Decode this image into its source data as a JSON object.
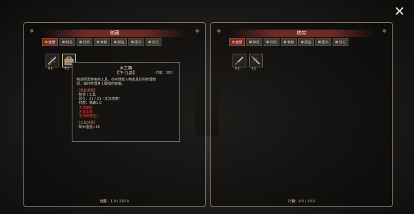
{
  "close_label": "×",
  "left_panel": {
    "title": "储藏",
    "tabs": [
      {
        "label": "全部",
        "active": true
      },
      {
        "label": "制造",
        "active": false
      },
      {
        "label": "药药",
        "active": false
      },
      {
        "label": "食粮",
        "active": false
      },
      {
        "label": "摸临",
        "active": false
      },
      {
        "label": "图书",
        "active": false
      },
      {
        "label": "其它",
        "active": false
      }
    ],
    "items": [
      {
        "icon": "saw-icon",
        "qty": "×1"
      },
      {
        "icon": "toolbox-icon",
        "qty": "×1"
      }
    ],
    "footer": "储藏：1.0 / 220.0"
  },
  "right_panel": {
    "title": "携带",
    "tabs": [
      {
        "label": "全部",
        "active": true
      },
      {
        "label": "制造",
        "active": false
      },
      {
        "label": "药药",
        "active": false
      },
      {
        "label": "食粮",
        "active": false
      },
      {
        "label": "摸临",
        "active": false
      },
      {
        "label": "图书",
        "active": false
      },
      {
        "label": "其它",
        "active": false
      }
    ],
    "items": [
      {
        "icon": "chisel-icon",
        "qty": "×1"
      },
      {
        "icon": "saw-icon",
        "qty": "×1"
      }
    ],
    "footer": "行囊：0.5 / 10.0"
  },
  "tooltip": {
    "name": "木工箱",
    "grade": "【下·九品】",
    "price": "· 价值：100",
    "desc1": "制造所需使用的工具，亦可随放入物道具栏的修理按",
    "desc2": "钮，临时修理身上破损的装备。",
    "section1": "【道具类型】",
    "type": "· 制造 / 工具",
    "durability": "· 耐久：21 / 21（无法修复）",
    "material": "· 材质：黄森1.0",
    "notes": [
      "· 无法精制",
      "· 无法淬毒",
      "· 无法转赠他人"
    ],
    "section2": "【工具效果】",
    "effect": "· 制木值值+10"
  },
  "colors": {
    "accent_red": "#6b2c26",
    "orange": "#d9823e",
    "warning_red": "#e2443a"
  }
}
